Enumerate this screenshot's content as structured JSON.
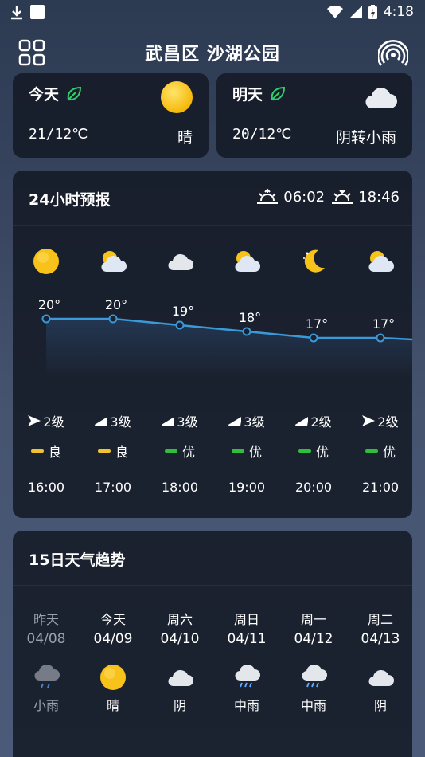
{
  "status_bar": {
    "time": "4:18"
  },
  "header": {
    "location": "武昌区 沙湖公园"
  },
  "today": {
    "label": "今天",
    "temp": "21/12℃",
    "condition": "晴"
  },
  "tomorrow": {
    "label": "明天",
    "temp": "20/12℃",
    "condition": "阴转小雨"
  },
  "forecast24": {
    "title": "24小时预报",
    "sunrise": "06:02",
    "sunset": "18:46",
    "hours": [
      {
        "time": "16:00",
        "temp": "20°",
        "icon": "sun-icon",
        "wind": "2级",
        "aqi": "良",
        "aqi_color": "#f2c12e"
      },
      {
        "time": "17:00",
        "temp": "20°",
        "icon": "partly-cloudy-icon",
        "wind": "3级",
        "aqi": "良",
        "aqi_color": "#f2c12e"
      },
      {
        "time": "18:00",
        "temp": "19°",
        "icon": "cloud-icon",
        "wind": "3级",
        "aqi": "优",
        "aqi_color": "#2fbf3a"
      },
      {
        "time": "19:00",
        "temp": "18°",
        "icon": "partly-cloudy-icon",
        "wind": "3级",
        "aqi": "优",
        "aqi_color": "#2fbf3a"
      },
      {
        "time": "20:00",
        "temp": "17°",
        "icon": "moon-icon",
        "wind": "2级",
        "aqi": "优",
        "aqi_color": "#2fbf3a"
      },
      {
        "time": "21:00",
        "temp": "17°",
        "icon": "partly-cloudy-icon",
        "wind": "2级",
        "aqi": "优",
        "aqi_color": "#2fbf3a"
      }
    ]
  },
  "chart_data": {
    "type": "line",
    "x": [
      "16:00",
      "17:00",
      "18:00",
      "19:00",
      "20:00",
      "21:00"
    ],
    "series": [
      {
        "values": [
          20,
          20,
          19,
          18,
          17,
          17
        ]
      }
    ]
  },
  "forecast15": {
    "title": "15日天气趋势",
    "days": [
      {
        "name": "昨天",
        "date": "04/08",
        "icon": "rain-icon",
        "condition": "小雨",
        "dim": true
      },
      {
        "name": "今天",
        "date": "04/09",
        "icon": "sun-icon",
        "condition": "晴",
        "dim": false
      },
      {
        "name": "周六",
        "date": "04/10",
        "icon": "cloud-icon",
        "condition": "阴",
        "dim": false
      },
      {
        "name": "周日",
        "date": "04/11",
        "icon": "rain-heavy-icon",
        "condition": "中雨",
        "dim": false
      },
      {
        "name": "周一",
        "date": "04/12",
        "icon": "rain-heavy-icon",
        "condition": "中雨",
        "dim": false
      },
      {
        "name": "周二",
        "date": "04/13",
        "icon": "cloud-icon",
        "condition": "阴",
        "dim": false
      }
    ]
  }
}
